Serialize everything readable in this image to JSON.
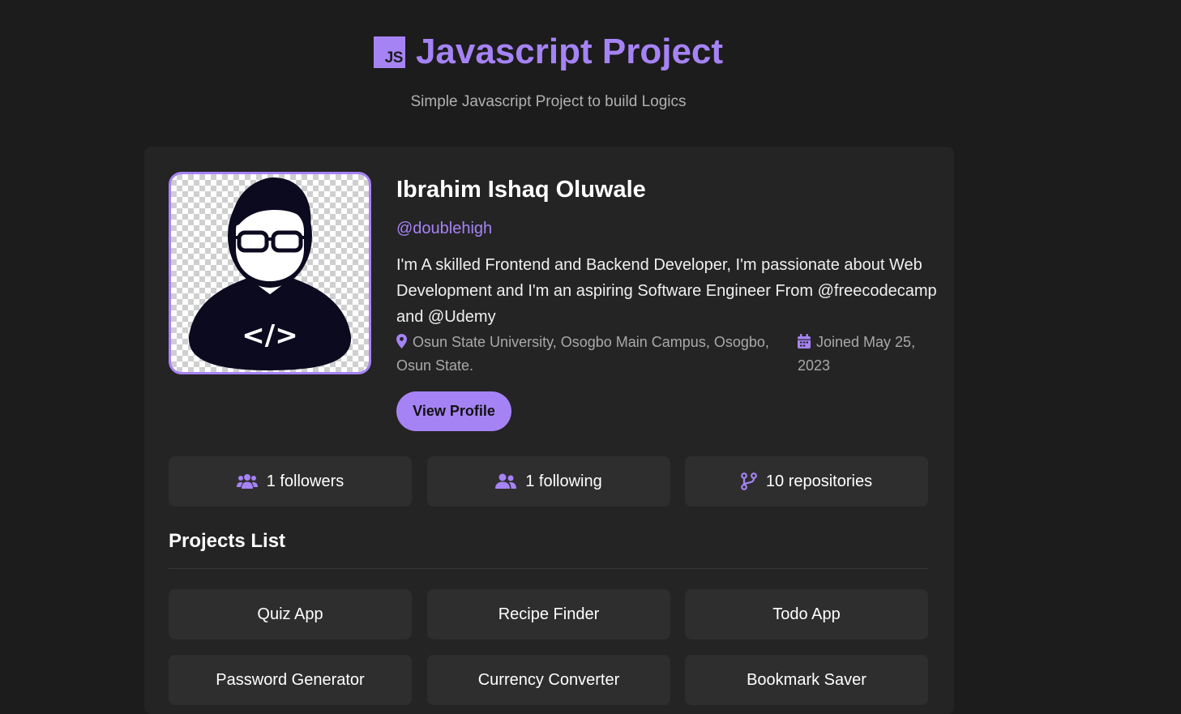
{
  "header": {
    "badge": "JS",
    "title": "Javascript Project",
    "subtitle": "Simple Javascript Project to build Logics"
  },
  "profile": {
    "name": "Ibrahim Ishaq Oluwale",
    "handle": "@doublehigh",
    "bio": "I'm A skilled Frontend and Backend Developer, I'm passionate about Web Development and I'm an aspiring Software Engineer From @freecodecamp and @Udemy",
    "location": "Osun State University, Osogbo Main Campus, Osogbo, Osun State.",
    "joined": "Joined May 25, 2023",
    "view_profile_label": "View Profile"
  },
  "stats": {
    "followers": "1 followers",
    "following": "1 following",
    "repositories": "10 repositories"
  },
  "projects": {
    "heading": "Projects List",
    "items": [
      "Quiz App",
      "Recipe Finder",
      "Todo App",
      "Password Generator",
      "Currency Converter",
      "Bookmark Saver"
    ]
  },
  "colors": {
    "background": "#1c1c1c",
    "card": "#242424",
    "tile": "#2e2e2e",
    "accent": "#a683f5",
    "muted_text": "#a9a9a9"
  },
  "icons": {
    "badge": "js-logo-icon",
    "location": "map-pin-icon",
    "joined": "calendar-icon",
    "followers": "users-icon",
    "following": "user-group-icon",
    "repositories": "code-branch-icon"
  }
}
